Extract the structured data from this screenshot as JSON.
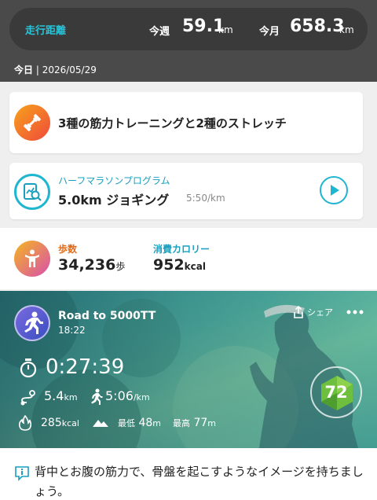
{
  "colors": {
    "accent": "#1fb6cf",
    "header_bg": "#4a4a4a",
    "steps_label": "#e36a16"
  },
  "distance": {
    "title": "走行距離",
    "week_label": "今週",
    "week_value": "59.1",
    "week_unit": "km",
    "month_label": "今月",
    "month_value": "658.3",
    "month_unit": "km"
  },
  "today": {
    "label": "今日",
    "date": "| 2026/05/29"
  },
  "strength_card": {
    "icon": "dumbbell-icon",
    "text": "3種の筋力トレーニングと2種のストレッチ"
  },
  "program_card": {
    "icon": "program-search-icon",
    "subtitle": "ハーフマラソンプログラム",
    "title": "5.0km ジョギング",
    "pace": "5:50/km",
    "action_icon": "play-icon"
  },
  "activity": {
    "steps_label": "歩数",
    "steps_value": "34,236",
    "steps_unit": "歩",
    "cal_label": "消費カロリー",
    "cal_value": "952",
    "cal_unit": "kcal"
  },
  "run": {
    "title": "Road to 5000TT",
    "time": "18:22",
    "share_label": "シェア",
    "duration": "0:27:39",
    "distance": "5.4",
    "distance_unit": "km",
    "pace": "5:06",
    "pace_unit": "/km",
    "calories": "285",
    "calories_unit": "kcal",
    "min_label": "最低",
    "min_value": "48",
    "min_unit": "m",
    "max_label": "最高",
    "max_value": "77",
    "max_unit": "m",
    "score": "72"
  },
  "tip": {
    "text": "背中とお腹の筋力で、骨盤を起こすようなイメージを持ちましょう。"
  }
}
